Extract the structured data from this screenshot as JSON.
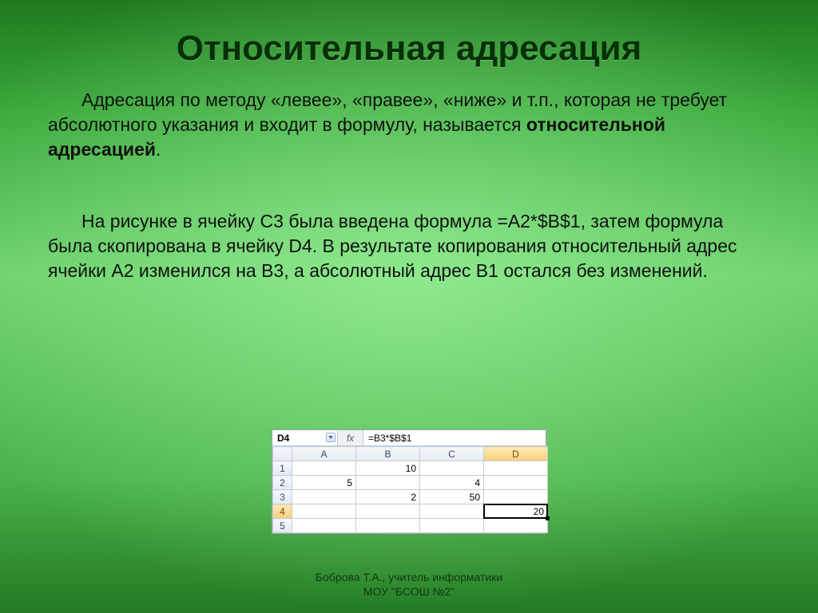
{
  "title": "Относительная адресация",
  "para1": {
    "t1": "Адресация по методу «левее», «правее», «ниже» и т.п., которая не требует абсолютного указания и входит в формулу, называется ",
    "bold": "относительной адресацией",
    "t2": "."
  },
  "para2": "На рисунке в ячейку С3 была введена формула =A2*$B$1, затем формула была скопирована в ячейку D4. В результате копирования относительный адрес ячейки А2 изменился на В3, а абсолютный адрес В1 остался без изменений.",
  "spreadsheet": {
    "name_box": "D4",
    "fx_label": "fx",
    "formula": "=B3*$B$1",
    "columns": [
      "A",
      "B",
      "C",
      "D"
    ],
    "row_headers": [
      "1",
      "2",
      "3",
      "4",
      "5"
    ],
    "active_col_index": 3,
    "active_row_index": 3,
    "cells": {
      "r0": {
        "A": "",
        "B": "10",
        "C": "",
        "D": ""
      },
      "r1": {
        "A": "5",
        "B": "",
        "C": "4",
        "D": ""
      },
      "r2": {
        "A": "",
        "B": "2",
        "C": "50",
        "D": ""
      },
      "r3": {
        "A": "",
        "B": "",
        "C": "",
        "D": "20"
      },
      "r4": {
        "A": "",
        "B": "",
        "C": "",
        "D": ""
      }
    }
  },
  "footer": {
    "line1": "Боброва Т.А., учитель информатики",
    "line2": "МОУ \"БСОШ №2\""
  }
}
